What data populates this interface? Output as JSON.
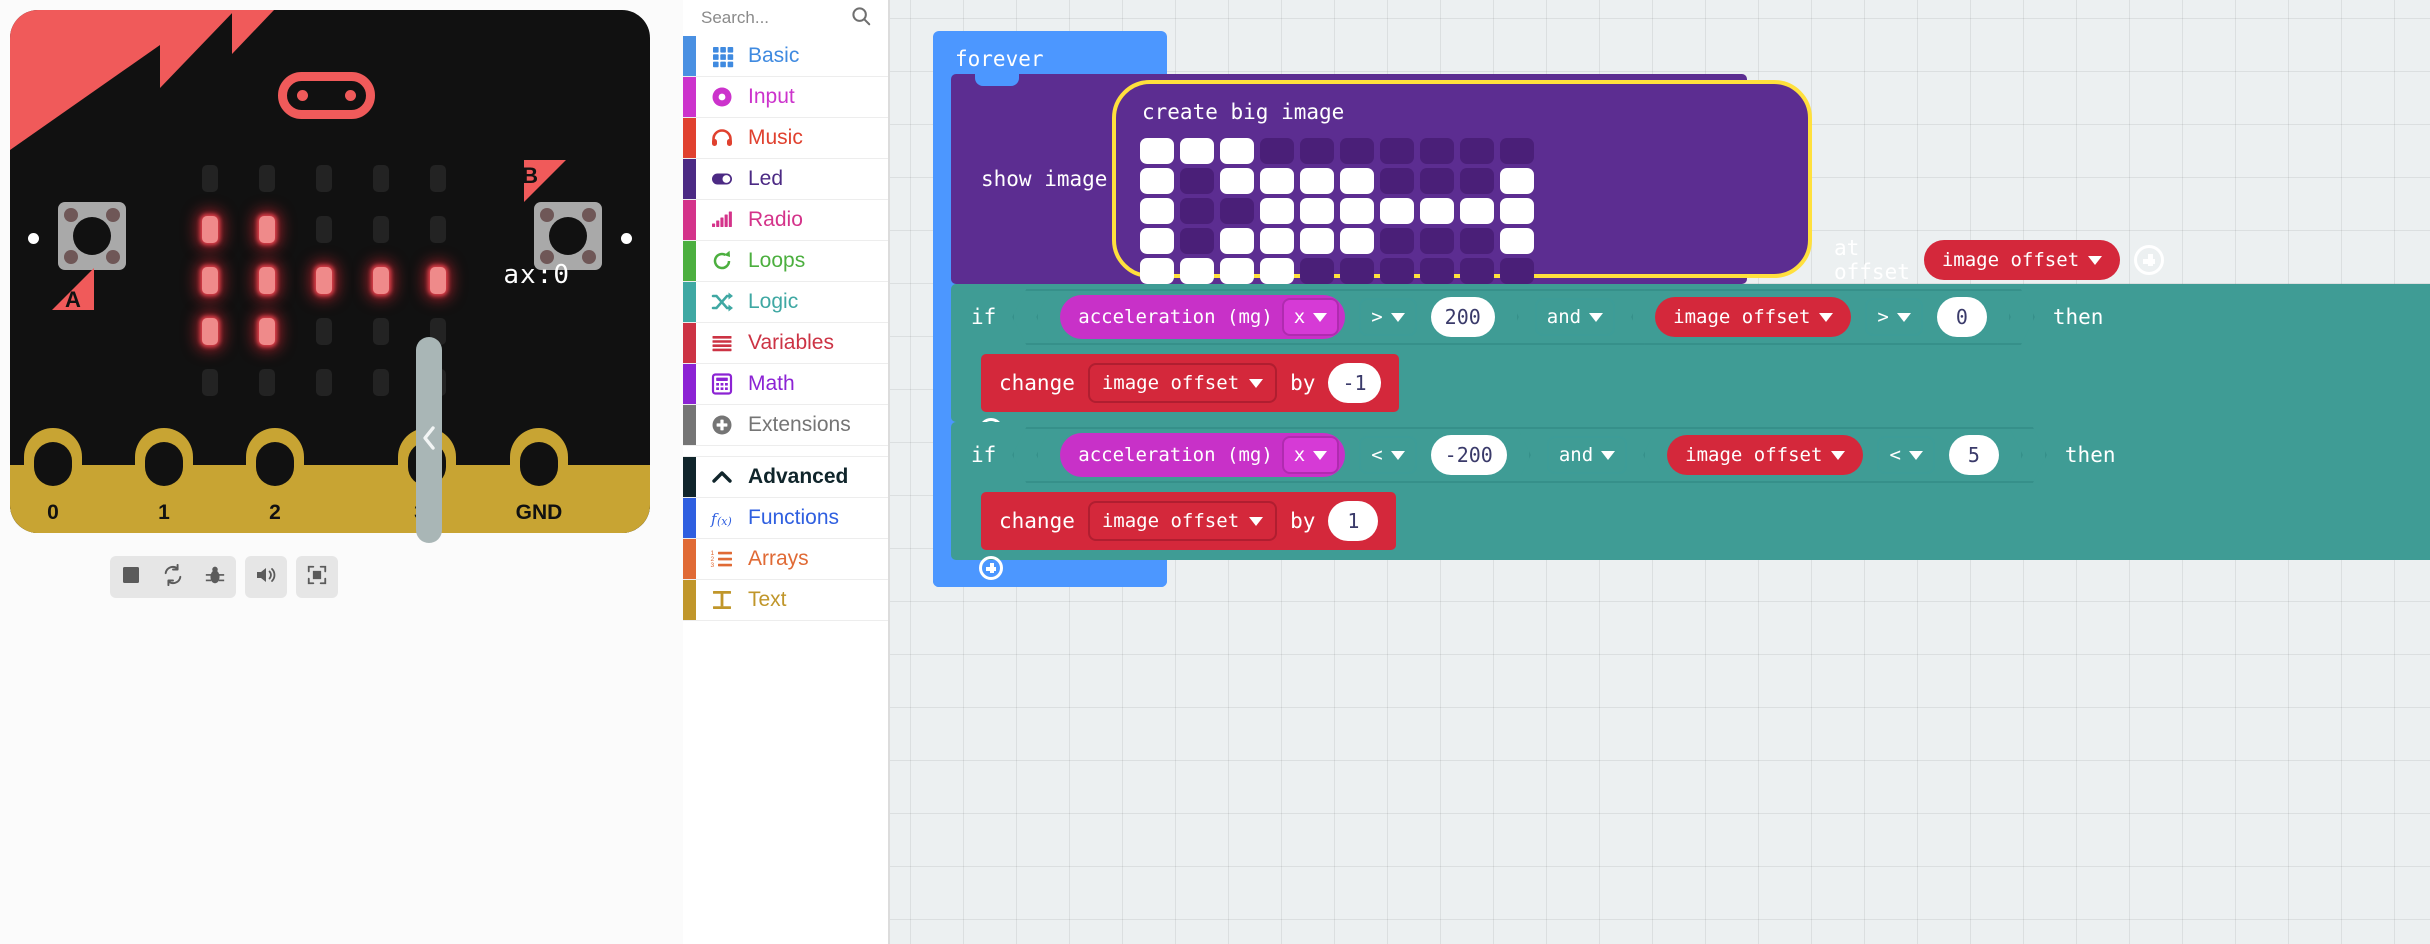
{
  "simulator": {
    "name": "microbit-simulator",
    "accel_readout": "ax:0",
    "button_a_label": "A",
    "button_b_label": "B",
    "pin_labels": [
      "0",
      "1",
      "2",
      "3V",
      "GND"
    ],
    "led_matrix": [
      [
        0,
        0,
        0,
        0,
        0
      ],
      [
        1,
        1,
        0,
        0,
        0
      ],
      [
        1,
        1,
        1,
        1,
        1
      ],
      [
        1,
        1,
        0,
        0,
        0
      ],
      [
        0,
        0,
        0,
        0,
        0
      ]
    ],
    "toolbar": [
      {
        "name": "stop-button",
        "icon": "stop-icon"
      },
      {
        "name": "restart-button",
        "icon": "restart-icon"
      },
      {
        "name": "debug-button",
        "icon": "bug-icon"
      },
      {
        "name": "mute-button",
        "icon": "speaker-icon"
      },
      {
        "name": "fullscreen-button",
        "icon": "fullscreen-icon"
      }
    ],
    "collapse_icon": "chevron-left-icon"
  },
  "toolbox": {
    "search_placeholder": "Search...",
    "search_icon": "search-icon",
    "categories": [
      {
        "label": "Basic",
        "color": "#4a90e2",
        "text": "#3f8ae0",
        "icon": "grid-icon"
      },
      {
        "label": "Input",
        "color": "#cc33cc",
        "text": "#cc33cc",
        "icon": "circle-dot-icon"
      },
      {
        "label": "Music",
        "color": "#e0412f",
        "text": "#e0412f",
        "icon": "headphones-icon"
      },
      {
        "label": "Led",
        "color": "#4c2a84",
        "text": "#4c2a84",
        "icon": "toggle-icon"
      },
      {
        "label": "Radio",
        "color": "#d4338a",
        "text": "#d4338a",
        "icon": "signal-bars-icon"
      },
      {
        "label": "Loops",
        "color": "#4caf3f",
        "text": "#4caf3f",
        "icon": "loop-arrow-icon"
      },
      {
        "label": "Logic",
        "color": "#3fa8a3",
        "text": "#3fa8a3",
        "icon": "shuffle-icon"
      },
      {
        "label": "Variables",
        "color": "#cc3344",
        "text": "#cc3344",
        "icon": "lines-icon"
      },
      {
        "label": "Math",
        "color": "#8c23d4",
        "text": "#8c23d4",
        "icon": "calculator-icon"
      },
      {
        "label": "Extensions",
        "color": "#757575",
        "text": "#757575",
        "icon": "plus-circle-icon"
      }
    ],
    "advanced": {
      "label": "Advanced",
      "color": "#10252b",
      "text": "#10252b",
      "icon": "chevron-up-icon"
    },
    "advanced_categories": [
      {
        "label": "Functions",
        "color": "#2f5fe0",
        "text": "#2f5fe0",
        "icon": "fx-icon"
      },
      {
        "label": "Arrays",
        "color": "#e06a35",
        "text": "#e06a35",
        "icon": "numbered-list-icon"
      },
      {
        "label": "Text",
        "color": "#c0962a",
        "text": "#c0962a",
        "icon": "text-icon"
      }
    ]
  },
  "workspace": {
    "forever": {
      "label": "forever",
      "color": "#4c97ff"
    },
    "show_image": {
      "label": "show image",
      "color": "#5c2d91",
      "at_offset_label": "at offset",
      "offset_variable": "image offset",
      "plus_icon": "add-input-icon",
      "big_image": {
        "label": "create big image",
        "highlight_color": "#ffe03d",
        "rows": 5,
        "cols": 10,
        "pixels": [
          [
            1,
            1,
            1,
            0,
            0,
            0,
            0,
            0,
            0,
            0
          ],
          [
            1,
            0,
            1,
            1,
            1,
            1,
            0,
            0,
            0,
            1
          ],
          [
            1,
            0,
            0,
            1,
            1,
            1,
            1,
            1,
            1,
            1
          ],
          [
            1,
            0,
            1,
            1,
            1,
            1,
            0,
            0,
            0,
            1
          ],
          [
            1,
            1,
            1,
            1,
            0,
            0,
            0,
            0,
            0,
            0
          ]
        ]
      }
    },
    "if_blocks": [
      {
        "keyword": "if",
        "then_label": "then",
        "color": "#3f9c95",
        "left": {
          "reporter": "acceleration (mg)",
          "axis": "x",
          "operator": ">",
          "value": "200"
        },
        "connector": "and",
        "right": {
          "variable": "image offset",
          "operator": ">",
          "value": "0"
        },
        "body": {
          "verb": "change",
          "variable": "image offset",
          "by_label": "by",
          "value": "-1",
          "color": "#d4283b"
        },
        "add_icon": "add-statement-icon"
      },
      {
        "keyword": "if",
        "then_label": "then",
        "color": "#3f9c95",
        "left": {
          "reporter": "acceleration (mg)",
          "axis": "x",
          "operator": "<",
          "value": "-200"
        },
        "connector": "and",
        "right": {
          "variable": "image offset",
          "operator": "<",
          "value": "5"
        },
        "body": {
          "verb": "change",
          "variable": "image offset",
          "by_label": "by",
          "value": "1",
          "color": "#d4283b"
        },
        "add_icon": "add-statement-icon"
      }
    ]
  }
}
